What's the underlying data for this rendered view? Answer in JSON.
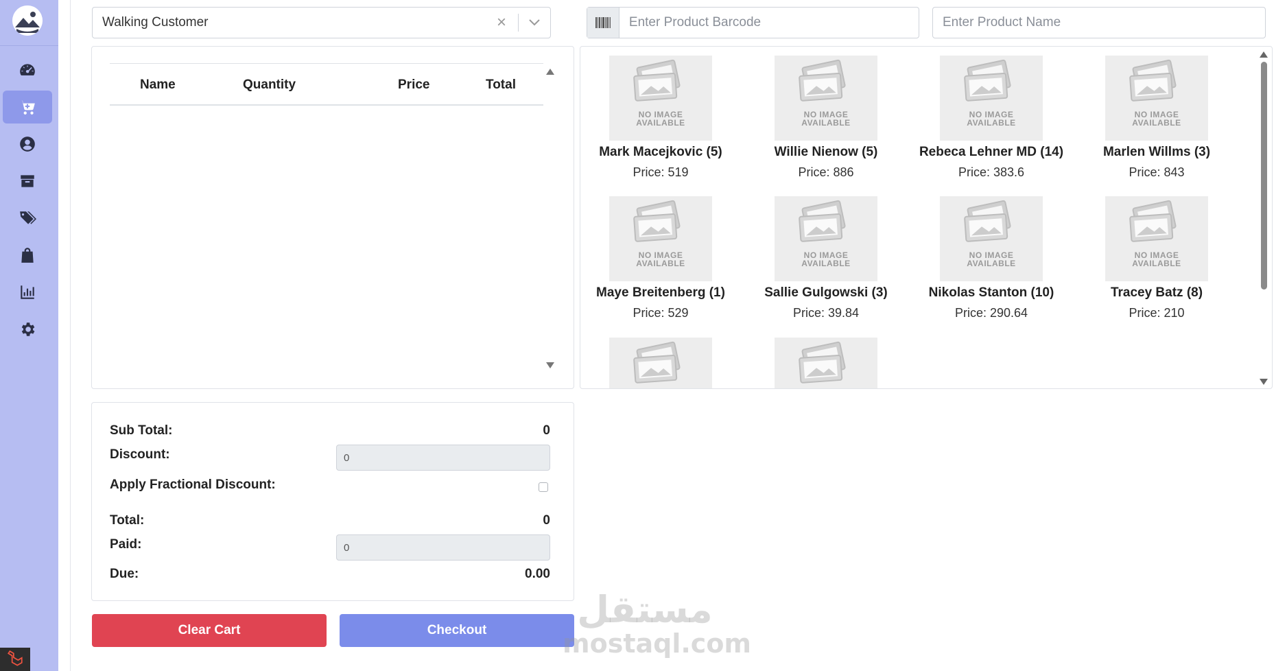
{
  "sidebar": {
    "items": [
      {
        "icon": "dashboard-gauge-icon",
        "active": false
      },
      {
        "icon": "cart-plus-icon",
        "active": true
      },
      {
        "icon": "user-circle-icon",
        "active": false
      },
      {
        "icon": "box-icon",
        "active": false
      },
      {
        "icon": "tags-icon",
        "active": false
      },
      {
        "icon": "shopping-bag-icon",
        "active": false
      },
      {
        "icon": "bar-chart-icon",
        "active": false
      },
      {
        "icon": "gear-icon",
        "active": false
      }
    ],
    "bottom_icon": "laravel-logo-icon",
    "colors": {
      "background": "#b6bdf2",
      "active": "#8e99ea",
      "icon": "#2b2f45"
    }
  },
  "customer": {
    "selected": "Walking Customer",
    "clear_symbol": "×"
  },
  "search": {
    "barcode_placeholder": "Enter Product Barcode",
    "name_placeholder": "Enter Product Name"
  },
  "cart": {
    "columns": [
      "Name",
      "Quantity",
      "Price",
      "Total"
    ],
    "rows": []
  },
  "products": [
    {
      "name": "Mark Macejkovic (5)",
      "price": "Price: 519"
    },
    {
      "name": "Willie Nienow (5)",
      "price": "Price: 886"
    },
    {
      "name": "Rebeca Lehner MD (14)",
      "price": "Price: 383.6"
    },
    {
      "name": "Marlen Willms (3)",
      "price": "Price: 843"
    },
    {
      "name": "Maye Breitenberg (1)",
      "price": "Price: 529"
    },
    {
      "name": "Sallie Gulgowski (3)",
      "price": "Price: 39.84"
    },
    {
      "name": "Nikolas Stanton (10)",
      "price": "Price: 290.64"
    },
    {
      "name": "Tracey Batz (8)",
      "price": "Price: 210"
    }
  ],
  "product_placeholder": {
    "line1": "NO IMAGE",
    "line2": "AVAILABLE"
  },
  "totals": {
    "subtotal_label": "Sub Total:",
    "subtotal_value": "0",
    "discount_label": "Discount:",
    "discount_value": "0",
    "fractional_label": "Apply Fractional Discount:",
    "total_label": "Total:",
    "total_value": "0",
    "paid_label": "Paid:",
    "paid_value": "0",
    "due_label": "Due:",
    "due_value": "0.00"
  },
  "actions": {
    "clear_label": "Clear Cart",
    "checkout_label": "Checkout",
    "colors": {
      "clear": "#e04452",
      "checkout": "#7b8cea"
    }
  },
  "watermark": {
    "arabic": "مستقل",
    "latin": "mostaql.com"
  }
}
